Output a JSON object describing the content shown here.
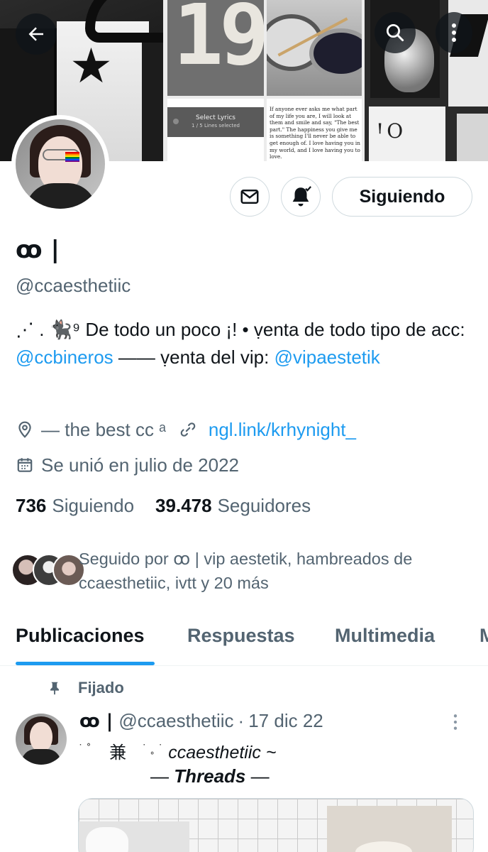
{
  "banner": {
    "tile_number": "19",
    "lyrics_title": "Select Lyrics",
    "lyrics_sub": "1 / 5 Lines selected",
    "quote_text": "If anyone ever asks me what part of my life you are, I will look at them and smile and say, \"The best part.\" The happiness you give me is something I'll never be able to get enough of. I love having you in my world, and I love having you to love.",
    "art_text": "ꞋO"
  },
  "profile": {
    "display_name": "ꝏ |",
    "handle": "@ccaesthetiic",
    "bio_part1": "⋰ . 🐈‍⬛⁹ De todo un poco ¡! • ṿenta de todo tipo de acc: ",
    "bio_link1": "@ccbineros",
    "bio_part2": " —— ṿenta del vip: ",
    "bio_link2": "@vipaestetik",
    "location": "— the best cc ᵃ",
    "url": "ngl.link/krhynight_",
    "joined": "Se unió en julio de 2022",
    "following_count": "736",
    "following_label": "Siguiendo",
    "followers_count": "39.478",
    "followers_label": "Seguidores",
    "followed_by": "Seguido por ꝏ | vip aestetik, hambreados de ccaesthetiic, ivtt y 20 más"
  },
  "actions": {
    "follow_label": "Siguiendo"
  },
  "tabs": [
    {
      "label": "Publicaciones",
      "active": true
    },
    {
      "label": "Respuestas",
      "active": false
    },
    {
      "label": "Multimedia",
      "active": false
    },
    {
      "label": "M",
      "active": false
    }
  ],
  "post": {
    "pinned_label": "Fijado",
    "author_name": "ꝏ |",
    "author_handle": "@ccaesthetiic",
    "separator": "·",
    "date": "17 dic 22",
    "line1_marks": "˙   ˚",
    "line1_char": "兼",
    "line1_marks2": "˙ ˳   ˙",
    "line1_text": "ccaesthetiic ~",
    "line2_pre": "— ",
    "line2_text": "Threads",
    "line2_post": " —"
  },
  "icons": [
    "back-arrow-icon",
    "search-icon",
    "more-vertical-icon",
    "mail-icon",
    "bell-check-icon",
    "location-icon",
    "link-icon",
    "calendar-icon",
    "pin-icon",
    "more-horizontal-icon"
  ],
  "colors": {
    "accent": "#1d9bf0",
    "secondary_text": "#536471",
    "primary_text": "#0f1419",
    "border": "#cfd9de"
  }
}
